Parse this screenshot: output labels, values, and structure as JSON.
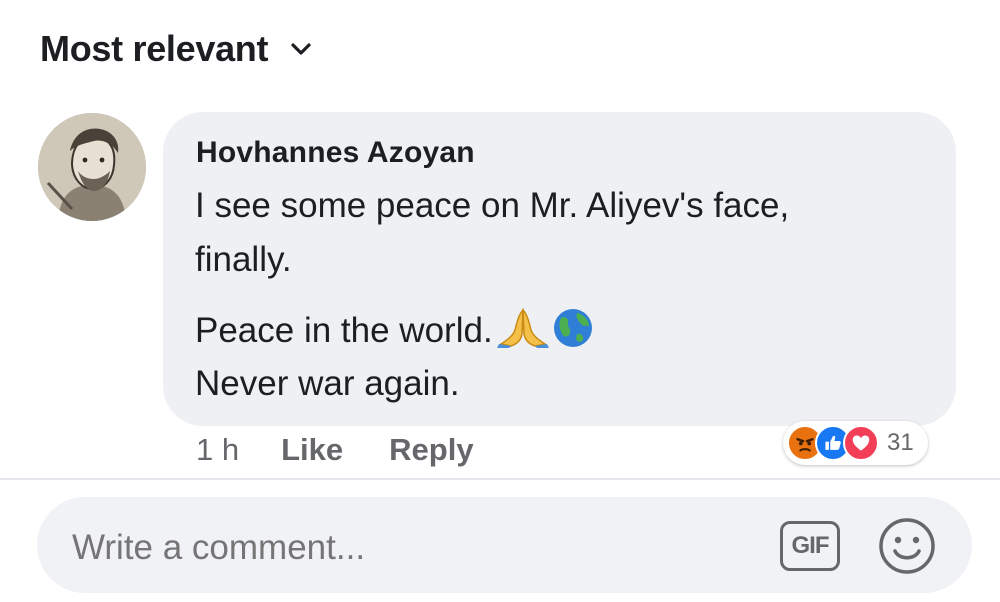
{
  "sort": {
    "label": "Most relevant",
    "icon": "chevron-down-icon"
  },
  "comment": {
    "author": "Hovhannes  Azoyan",
    "lines": [
      "I see some peace on Mr. Aliyev's face,",
      "finally.",
      "Peace in the world.",
      "Never war again."
    ],
    "emojis": [
      "folded-hands-icon",
      "globe-icon"
    ],
    "time": "1 h",
    "like_label": "Like",
    "reply_label": "Reply",
    "reactions": {
      "icons": [
        "angry-reaction-icon",
        "like-reaction-icon",
        "love-reaction-icon"
      ],
      "count": "31"
    }
  },
  "composer": {
    "placeholder": "Write a comment...",
    "gif_label": "GIF",
    "emoji_icon": "smiley-icon"
  },
  "colors": {
    "bubble": "#eef0f3",
    "meta_text": "#65676b",
    "like_blue": "#1877f2",
    "love_red": "#f33e58",
    "angry_orange": "#e9710f"
  }
}
